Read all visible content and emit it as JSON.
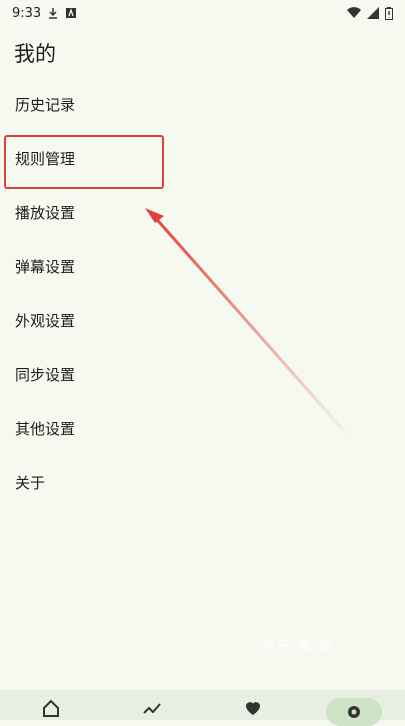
{
  "status": {
    "time": "9:33"
  },
  "page": {
    "title": "我的"
  },
  "menu": [
    {
      "label": "历史记录"
    },
    {
      "label": "规则管理"
    },
    {
      "label": "播放设置"
    },
    {
      "label": "弹幕设置"
    },
    {
      "label": "外观设置"
    },
    {
      "label": "同步设置"
    },
    {
      "label": "其他设置"
    },
    {
      "label": "关于"
    }
  ],
  "watermark": "乐乐 看 家",
  "colors": {
    "background": "#f6f9ef",
    "highlight": "#e0403a",
    "nav_active": "#cfe3c7"
  },
  "bottom_nav": [
    {
      "icon": "home-icon"
    },
    {
      "icon": "trending-icon"
    },
    {
      "icon": "heart-icon"
    },
    {
      "icon": "settings-icon",
      "active": true
    }
  ]
}
